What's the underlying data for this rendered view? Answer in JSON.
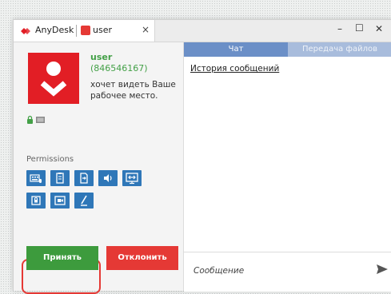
{
  "titlebar": {
    "app_name": "AnyDesk",
    "tab_user": "user",
    "close_tab": "×",
    "minimize": "–",
    "maximize": "☐",
    "close_window": "✕"
  },
  "request": {
    "username": "user",
    "id": "(846546167)",
    "message": "хочет видеть Ваше рабочее место."
  },
  "permissions": {
    "title": "Permissions",
    "icons": [
      "keyboard-mouse-icon",
      "clipboard-icon",
      "file-transfer-icon",
      "sound-icon",
      "remote-control-icon",
      "lock-icon",
      "record-session-icon",
      "pen-draw-icon"
    ]
  },
  "actions": {
    "accept": "Принять",
    "decline": "Отклонить"
  },
  "chat": {
    "tab_chat": "Чат",
    "tab_files": "Передача файлов",
    "history": "История сообщений",
    "placeholder": "Сообщение"
  },
  "colors": {
    "brand_red": "#e21e25",
    "accept_green": "#3d9b3d",
    "decline_red": "#e53935",
    "permission_blue": "#2f77b8",
    "tab_active": "#6b8fc7",
    "tab_inactive": "#a8bcdc",
    "user_green": "#43a047"
  }
}
